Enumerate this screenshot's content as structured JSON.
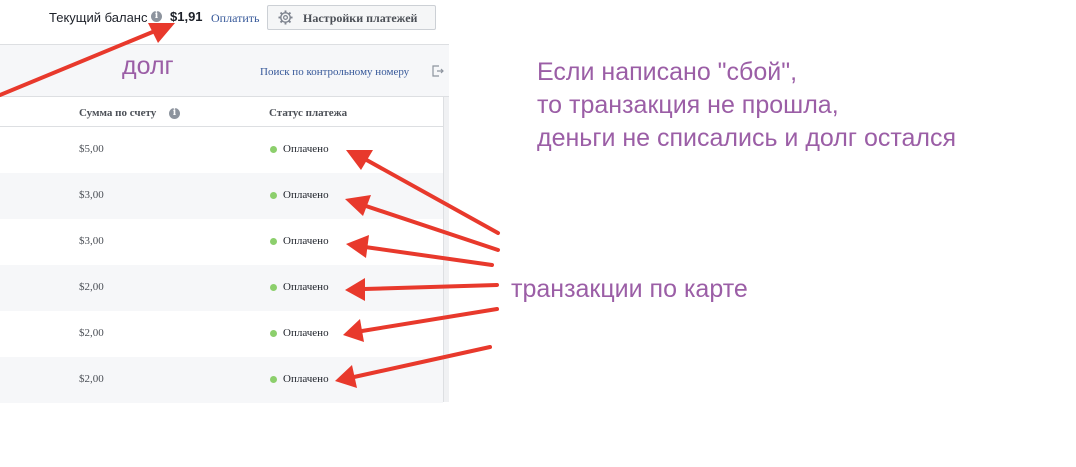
{
  "topbar": {
    "balance_label": "Текущий баланс",
    "balance_value": "$1,91",
    "pay_link": "Оплатить",
    "settings_button": "Настройки платежей"
  },
  "panel": {
    "search_link": "Поиск по контрольному номеру",
    "columns": {
      "amount": "Сумма по счету",
      "status": "Статус платежа"
    },
    "rows": [
      {
        "amount": "$5,00",
        "status": "Оплачено"
      },
      {
        "amount": "$3,00",
        "status": "Оплачено"
      },
      {
        "amount": "$3,00",
        "status": "Оплачено"
      },
      {
        "amount": "$2,00",
        "status": "Оплачено"
      },
      {
        "amount": "$2,00",
        "status": "Оплачено"
      },
      {
        "amount": "$2,00",
        "status": "Оплачено"
      }
    ]
  },
  "annotations": {
    "debt": "долг",
    "failure_note": [
      "Если написано \"сбой\",",
      "то транзакция не прошла,",
      "деньги не списались и долг остался"
    ],
    "card_transactions": "транзакции по карте"
  },
  "colors": {
    "annotation": "#9b5ea6",
    "arrow": "#e8392c",
    "paid_dot": "#8ccf6c",
    "link": "#365899"
  }
}
